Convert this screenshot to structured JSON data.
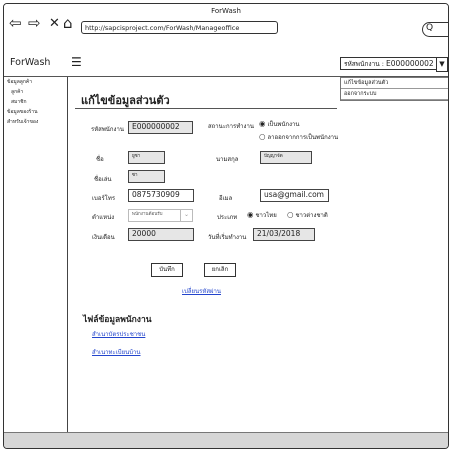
{
  "browser": {
    "title": "ForWash",
    "url": "http://sapcisproject.com/ForWash/Manageoffice",
    "search_glyph": "Q"
  },
  "app": {
    "brand": "ForWash",
    "user_select": {
      "prefix": "รหัสพนักงาน :",
      "value": "E000000002"
    },
    "user_menu": [
      "แก้ไขข้อมูลส่วนตัว",
      "ออกจากระบบ"
    ]
  },
  "sidebar": {
    "items": [
      {
        "label": "ข้อมูลลูกค้า"
      },
      {
        "label": "ลูกค้า"
      },
      {
        "label": "สมาชิก"
      },
      {
        "label": "ข้อมูลของร้าน"
      },
      {
        "label": "สำหรับเจ้าของ"
      }
    ]
  },
  "form": {
    "title": "แก้ไขข้อมูลส่วนตัว",
    "employee_id": {
      "label": "รหัสพนักงาน",
      "value": "E000000002"
    },
    "status": {
      "label": "สถานะการทำงาน",
      "options": [
        "เป็นพนักงาน",
        "ลาออกจากการเป็นพนักงาน"
      ]
    },
    "first_name": {
      "label": "ชื่อ",
      "value": "ยูซา"
    },
    "last_name": {
      "label": "นามสกุล",
      "value": "ปัญญาจัด"
    },
    "nickname": {
      "label": "ชื่อเล่น",
      "value": "ซา"
    },
    "phone": {
      "label": "เบอร์โทร",
      "value": "0875730909"
    },
    "email": {
      "label": "อีเมล",
      "value": "usa@gmail.com"
    },
    "position": {
      "label": "ตำแหน่ง",
      "value": "พนักงานต้อนรับ"
    },
    "nationality": {
      "label": "ประเภท",
      "options": [
        "ชาวไทย",
        "ชาวต่างชาติ"
      ]
    },
    "salary": {
      "label": "เงินเดือน",
      "value": "20000"
    },
    "start_date": {
      "label": "วันที่เริ่มทำงาน",
      "value": "21/03/2018"
    },
    "save_label": "บันทึก",
    "cancel_label": "ยกเลิก",
    "change_password_link": "เปลี่ยนรหัสผ่าน"
  },
  "files": {
    "title": "ไฟล์ข้อมูลพนักงาน",
    "links": [
      "สำเนาบัตรประชาชน",
      "สำเนาทะเบียนบ้าน"
    ]
  }
}
